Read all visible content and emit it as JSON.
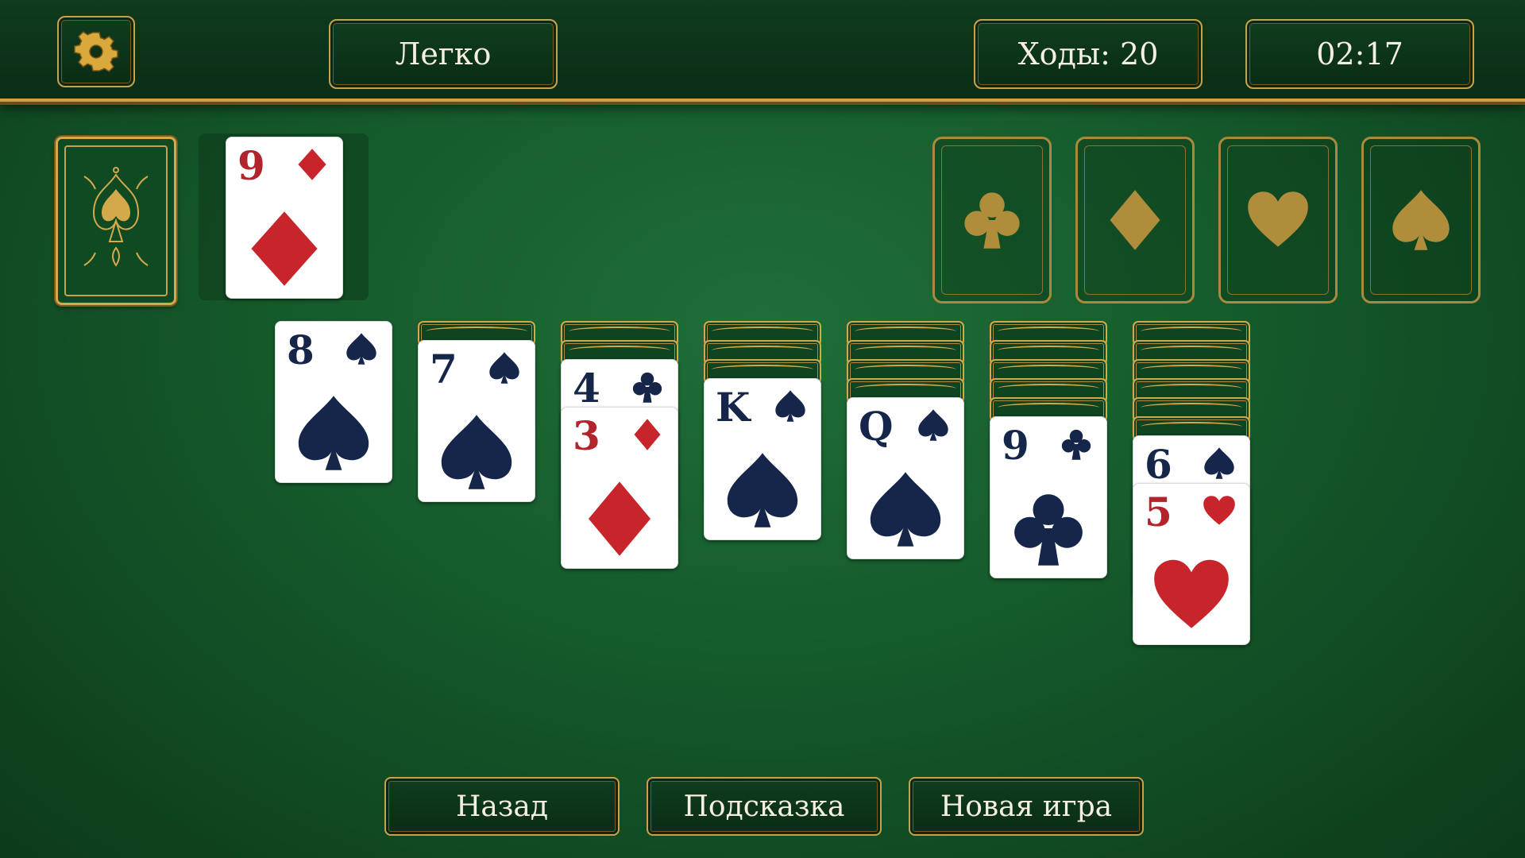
{
  "header": {
    "difficulty": "Легко",
    "moves": "Ходы: 20",
    "timer": "02:17",
    "settings_icon": "gear-icon"
  },
  "colors": {
    "felt": "#155a2b",
    "gold": "#c9a14a",
    "red_suit": "#c8242b",
    "dark_suit": "#15264a"
  },
  "stock": {
    "icon": "spade-ornament-icon"
  },
  "waste": {
    "rank": "9",
    "suit": "diamond"
  },
  "foundations": [
    {
      "suit": "club"
    },
    {
      "suit": "diamond"
    },
    {
      "suit": "heart"
    },
    {
      "suit": "spade"
    }
  ],
  "tableau": [
    {
      "face_down": 0,
      "face_up": [
        {
          "rank": "8",
          "suit": "spade"
        }
      ]
    },
    {
      "face_down": 1,
      "face_up": [
        {
          "rank": "7",
          "suit": "spade"
        }
      ]
    },
    {
      "face_down": 2,
      "face_up": [
        {
          "rank": "4",
          "suit": "club"
        },
        {
          "rank": "3",
          "suit": "diamond"
        }
      ]
    },
    {
      "face_down": 3,
      "face_up": [
        {
          "rank": "K",
          "suit": "spade"
        }
      ]
    },
    {
      "face_down": 4,
      "face_up": [
        {
          "rank": "Q",
          "suit": "spade"
        }
      ]
    },
    {
      "face_down": 5,
      "face_up": [
        {
          "rank": "9",
          "suit": "club"
        }
      ]
    },
    {
      "face_down": 6,
      "face_up": [
        {
          "rank": "6",
          "suit": "spade"
        },
        {
          "rank": "5",
          "suit": "heart"
        }
      ]
    }
  ],
  "footer": {
    "back": "Назад",
    "hint": "Подсказка",
    "new_game": "Новая игра"
  }
}
